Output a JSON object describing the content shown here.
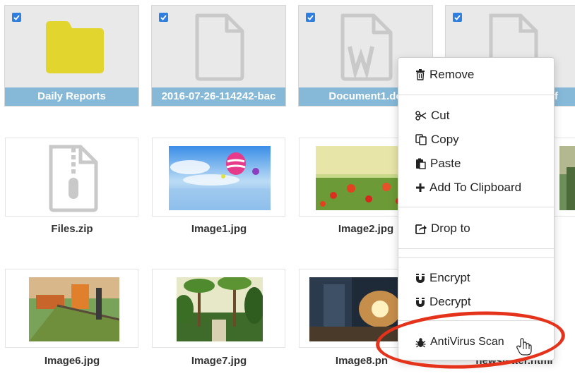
{
  "files": [
    {
      "name": "Daily Reports",
      "type": "folder",
      "selected": true,
      "icon": "folder-icon"
    },
    {
      "name": "2016-07-26-114242-bac",
      "type": "file",
      "selected": true,
      "icon": "file-icon"
    },
    {
      "name": "Document1.do",
      "type": "word",
      "selected": true,
      "icon": "word-document-icon"
    },
    {
      "name": "f",
      "type": "pdf",
      "selected": true,
      "icon": "pdf-document-icon"
    },
    {
      "name": "Files.zip",
      "type": "zip",
      "icon": "zip-file-icon"
    },
    {
      "name": "Image1.jpg",
      "type": "image"
    },
    {
      "name": "Image2.jpg",
      "type": "image"
    },
    {
      "name": "Image6.jpg",
      "type": "image"
    },
    {
      "name": "Image7.jpg",
      "type": "image"
    },
    {
      "name": "Image8.pn",
      "type": "image"
    },
    {
      "name": "newsletter.html",
      "type": "html"
    }
  ],
  "context_menu": {
    "remove": {
      "label": "Remove",
      "icon": "trash-icon"
    },
    "cut": {
      "label": "Cut",
      "icon": "scissors-icon"
    },
    "copy": {
      "label": "Copy",
      "icon": "copy-icon"
    },
    "paste": {
      "label": "Paste",
      "icon": "paste-icon"
    },
    "add_to_clipboard": {
      "label": "Add To Clipboard",
      "icon": "plus-icon"
    },
    "drop_to": {
      "label": "Drop to",
      "icon": "share-icon"
    },
    "encrypt": {
      "label": "Encrypt",
      "icon": "magnet-icon"
    },
    "decrypt": {
      "label": "Decrypt",
      "icon": "magnet-icon"
    },
    "antivirus": {
      "label": "AntiVirus Scan",
      "icon": "bug-icon"
    }
  },
  "colors": {
    "caption_bar": "#86b9d8",
    "checkbox": "#2f7fe0",
    "folder": "#e1d52e",
    "highlight_ring": "#e5321b"
  }
}
